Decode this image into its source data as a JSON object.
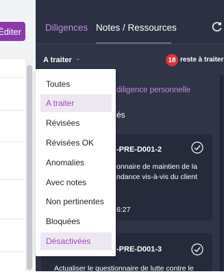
{
  "left": {
    "edit_label": "Éditer"
  },
  "tabs": [
    {
      "label": "Diligences"
    },
    {
      "label": "Notes / Ressources"
    }
  ],
  "filter": {
    "label": "A traiter",
    "count": "18",
    "count_label": "reste à traiter"
  },
  "panel": {
    "add_link": "diligence personnelle",
    "section": "és"
  },
  "cards": [
    {
      "title": "-PRE-D001-2",
      "desc": "onnaire de maintien de la ndance vis-à-vis du client",
      "time": "6:27"
    },
    {
      "title": "-PRE-D001-3",
      "desc": "Actualiser le questionnaire de lutte contre le"
    }
  ],
  "dropdown": {
    "options": [
      "Toutes",
      "A traiter",
      "Révisées",
      "Révisées OK",
      "Anomalies",
      "Avec notes",
      "Non pertinentes",
      "Bloquées",
      "Désactivées"
    ],
    "selected": "A traiter",
    "hovered": "Désactivées"
  },
  "colors": {
    "accent": "#9b47c2",
    "panel": "#2f3446",
    "badge": "#e0303a"
  }
}
